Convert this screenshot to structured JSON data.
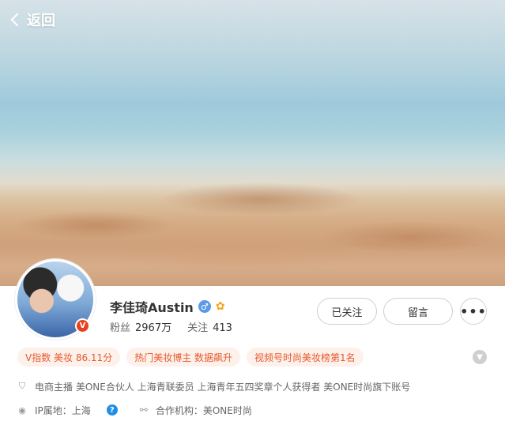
{
  "header": {
    "back_label": "返回"
  },
  "profile": {
    "name": "李佳琦Austin",
    "avatar_badge": "V",
    "gender_symbol": "♂",
    "stats": [
      {
        "label": "粉丝",
        "value": "2967万"
      },
      {
        "label": "关注",
        "value": "413"
      }
    ]
  },
  "actions": {
    "follow_label": "已关注",
    "message_label": "留言",
    "more_label": "•••"
  },
  "tags": [
    "V指数 美妆 86.11分",
    "热门美妆博主 数据飙升",
    "视频号时尚美妆榜第1名"
  ],
  "certification": "电商主播 美ONE合伙人 上海青联委员 上海青年五四奖章个人获得者 美ONE时尚旗下账号",
  "ip_location": "IP属地：上海",
  "help_symbol": "?",
  "org_info": "合作机构：美ONE时尚",
  "colors": {
    "accent_orange": "#e8592b",
    "tag_bg": "#fdf1ec",
    "help_blue": "#1f8fe5"
  },
  "icons": {
    "back": "chevron-left-icon",
    "gender": "male-icon",
    "vip": "crown-icon",
    "certification": "shield-icon",
    "ip": "location-pin-icon",
    "help": "question-icon",
    "org": "org-link-icon",
    "expand": "chevron-down-icon"
  }
}
